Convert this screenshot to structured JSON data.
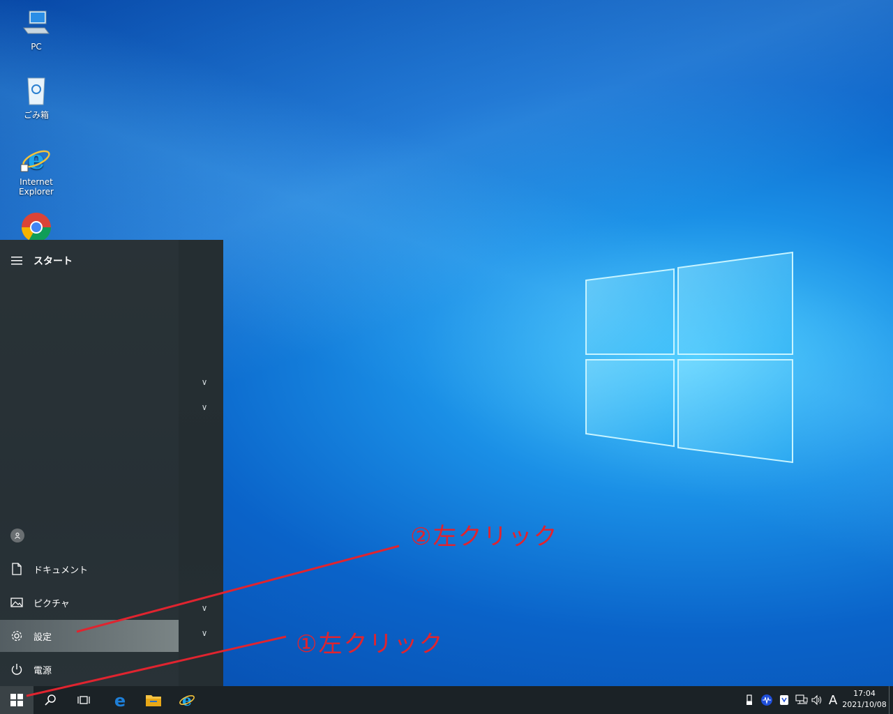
{
  "desktop": {
    "icons": [
      {
        "label": "PC",
        "icon": "pc-icon"
      },
      {
        "label": "ごみ箱",
        "icon": "recycle-bin-icon"
      },
      {
        "label": "Internet Explorer",
        "icon": "internet-explorer-icon"
      },
      {
        "label": "",
        "icon": "chrome-icon"
      }
    ]
  },
  "start_menu": {
    "title": "スタート",
    "items": {
      "documents": "ドキュメント",
      "pictures": "ピクチャ",
      "settings": "設定",
      "power": "電源"
    }
  },
  "taskbar": {
    "time": "17:04",
    "date": "2021/10/08",
    "ime": "A"
  },
  "annotations": {
    "step2": "②左クリック",
    "step1": "①左クリック",
    "color": "#e0242f"
  }
}
